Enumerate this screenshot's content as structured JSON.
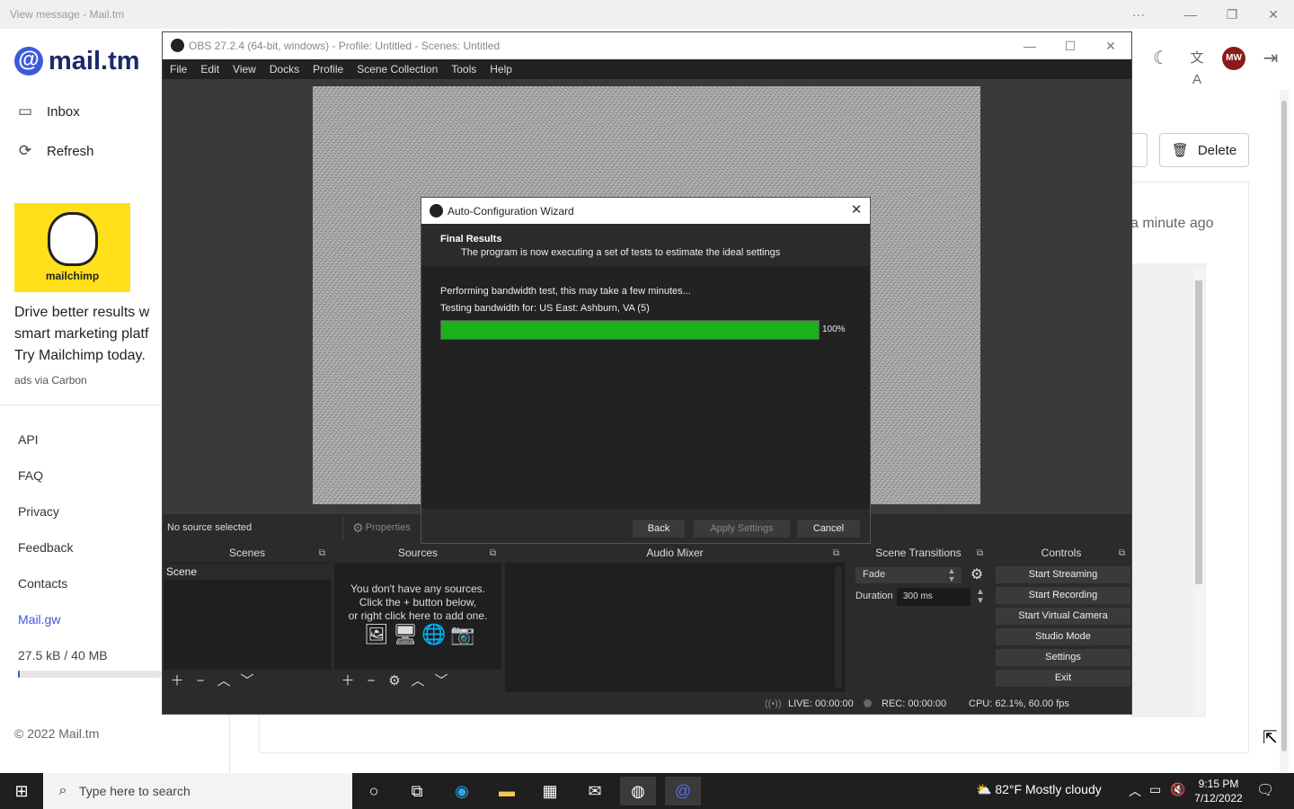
{
  "browser": {
    "title": "View message - Mail.tm",
    "controls": {
      "more": "···",
      "minimize": "—",
      "restore": "❐",
      "close": "✕"
    }
  },
  "mailtm": {
    "logo_symbol": "@",
    "logo_text": "mail.tm",
    "nav": [
      {
        "label": "Inbox",
        "icon": "inbox-icon",
        "glyph": "▭"
      },
      {
        "label": "Refresh",
        "icon": "refresh-icon",
        "glyph": "⟳"
      }
    ],
    "ad": {
      "brand": "mailchimp",
      "text_line1": "Drive better results w",
      "text_line2": "smart marketing platf",
      "text_line3": "Try Mailchimp today.",
      "via": "ads via Carbon"
    },
    "links": [
      "API",
      "FAQ",
      "Privacy",
      "Feedback",
      "Contacts",
      "Mail.gw"
    ],
    "storage_used": "27.5 kB",
    "storage_total": "/ 40 MB",
    "storage_fraction": 0.001,
    "copyright": "© 2022 Mail.tm",
    "topbar": {
      "moon": "☾",
      "translate": "文A",
      "avatar": "MW",
      "logout": "⇥"
    },
    "delete_label": "Delete",
    "delete_glyph": "🗑",
    "message_time": "a minute ago",
    "accent_color": "#3b5bdb"
  },
  "obs": {
    "title": "OBS 27.2.4 (64-bit, windows) - Profile: Untitled - Scenes: Untitled",
    "controls": {
      "minimize": "—",
      "maximize": "☐",
      "close": "✕"
    },
    "menu": [
      "File",
      "Edit",
      "View",
      "Docks",
      "Profile",
      "Scene Collection",
      "Tools",
      "Help"
    ],
    "no_source": "No source selected",
    "properties_label": "Properties",
    "docks": {
      "scenes": "Scenes",
      "sources": "Sources",
      "mixer": "Audio Mixer",
      "transitions": "Scene Transitions",
      "controls": "Controls"
    },
    "scene_name": "Scene",
    "sources_empty_line1": "You don't have any sources.",
    "sources_empty_line2": "Click the + button below,",
    "sources_empty_line3": "or right click here to add one.",
    "transition": "Fade",
    "duration_label": "Duration",
    "duration_value": "300 ms",
    "buttons": [
      "Start Streaming",
      "Start Recording",
      "Start Virtual Camera",
      "Studio Mode",
      "Settings",
      "Exit"
    ],
    "status": {
      "live": "LIVE: 00:00:00",
      "rec": "REC: 00:00:00",
      "cpu": "CPU: 62.1%, 60.00 fps"
    }
  },
  "wizard": {
    "title": "Auto-Configuration Wizard",
    "header": "Final Results",
    "subheader": "The program is now executing a set of tests to estimate the ideal settings",
    "status_line1": "Performing bandwidth test, this may take a few minutes...",
    "status_line2": "Testing bandwidth for: US East: Ashburn, VA (5)",
    "progress_fraction": 1.0,
    "progress_text": "100%",
    "progress_color": "#1cb01c",
    "back_label": "Back",
    "apply_label": "Apply Settings",
    "cancel_label": "Cancel"
  },
  "taskbar": {
    "search_placeholder": "Type here to search",
    "weather": "82°F  Mostly cloudy",
    "time": "9:15 PM",
    "date": "7/12/2022"
  }
}
